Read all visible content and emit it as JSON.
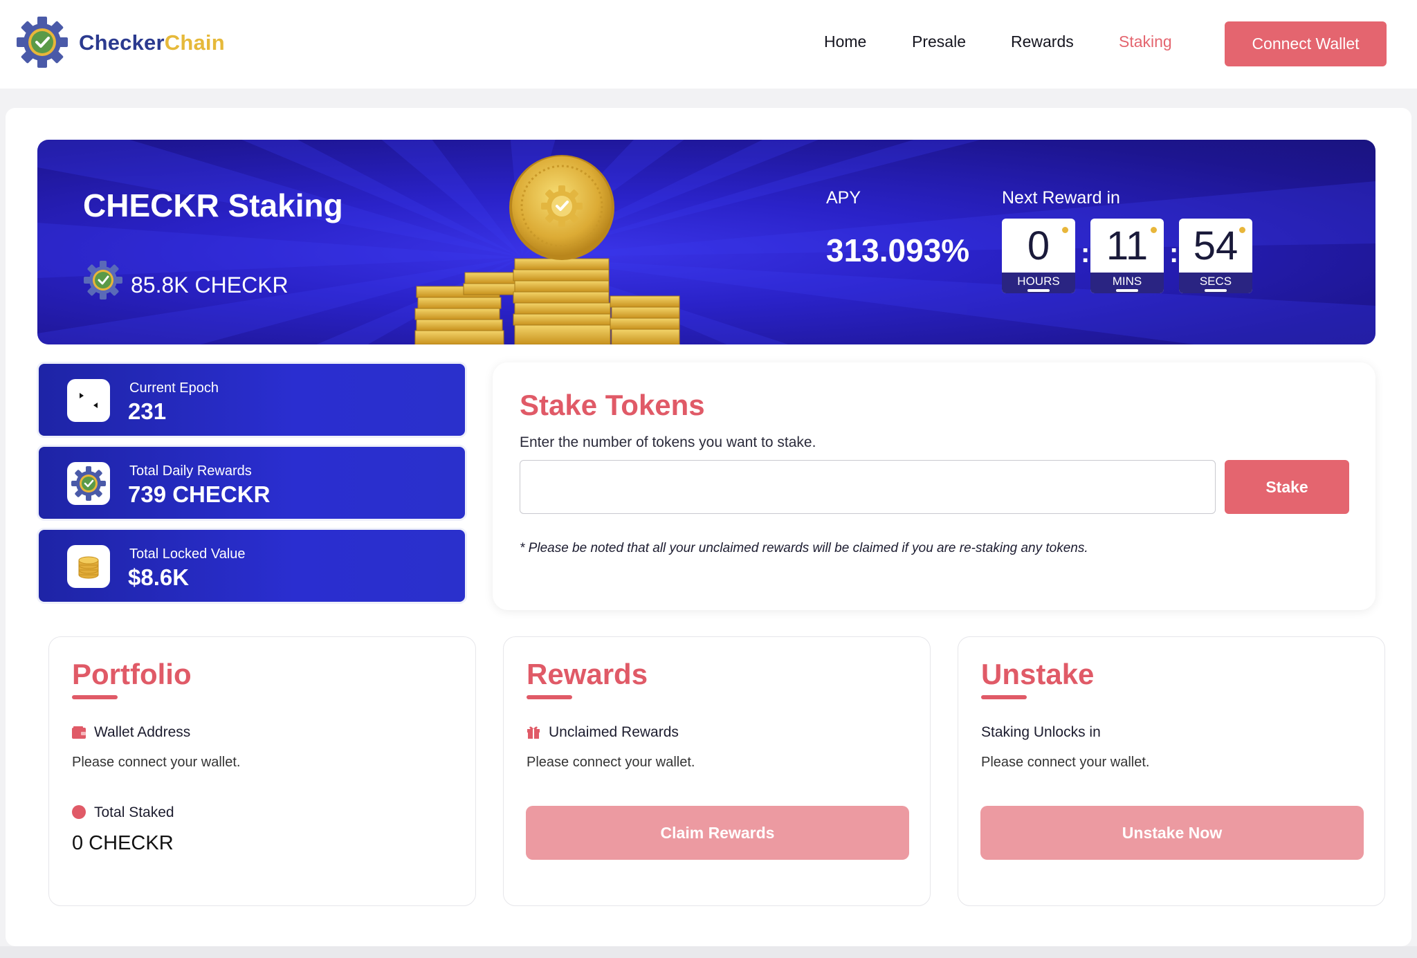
{
  "header": {
    "brand_part1": "Checker",
    "brand_part2": "Chain",
    "logo_icon": "checkerchain-gear-check-icon",
    "nav": [
      {
        "label": "Home"
      },
      {
        "label": "Presale"
      },
      {
        "label": "Rewards"
      },
      {
        "label": "Staking",
        "active": true
      }
    ],
    "connect_label": "Connect Wallet"
  },
  "hero": {
    "title": "CHECKR Staking",
    "amount": "85.8K CHECKR",
    "apy_label": "APY",
    "apy_value": "313.093%",
    "next_reward_label": "Next Reward in",
    "timer": {
      "hours": "0",
      "hours_label": "HOURS",
      "mins": "11",
      "mins_label": "MINS",
      "secs": "54",
      "secs_label": "SECS",
      "separator": ":"
    }
  },
  "stats": [
    {
      "label": "Current Epoch",
      "value": "231",
      "icon": "dice-icon"
    },
    {
      "label": "Total Daily Rewards",
      "value": "739 CHECKR",
      "icon": "checkr-gear-icon"
    },
    {
      "label": "Total Locked Value",
      "value": "$8.6K",
      "icon": "coin-stack-icon"
    }
  ],
  "stake": {
    "title": "Stake Tokens",
    "subtitle": "Enter the number of tokens you want to stake.",
    "input_value": "",
    "button_label": "Stake",
    "note": "* Please be noted that all your unclaimed rewards will be claimed if you are re-staking any tokens."
  },
  "portfolio": {
    "title": "Portfolio",
    "wallet_label": "Wallet Address",
    "wallet_status": "Please connect your wallet.",
    "staked_label": "Total Staked",
    "staked_value": "0 CHECKR"
  },
  "rewards": {
    "title": "Rewards",
    "unclaimed_label": "Unclaimed Rewards",
    "status": "Please connect your wallet.",
    "button_label": "Claim Rewards"
  },
  "unstake": {
    "title": "Unstake",
    "unlock_label": "Staking Unlocks in",
    "status": "Please connect your wallet.",
    "button_label": "Unstake Now"
  },
  "colors": {
    "accent": "#e4656f",
    "accent_light": "#ec9aa1",
    "hero_blue": "#2a22c8",
    "brand_navy": "#2b3a8f",
    "brand_gold": "#e6b93a"
  }
}
